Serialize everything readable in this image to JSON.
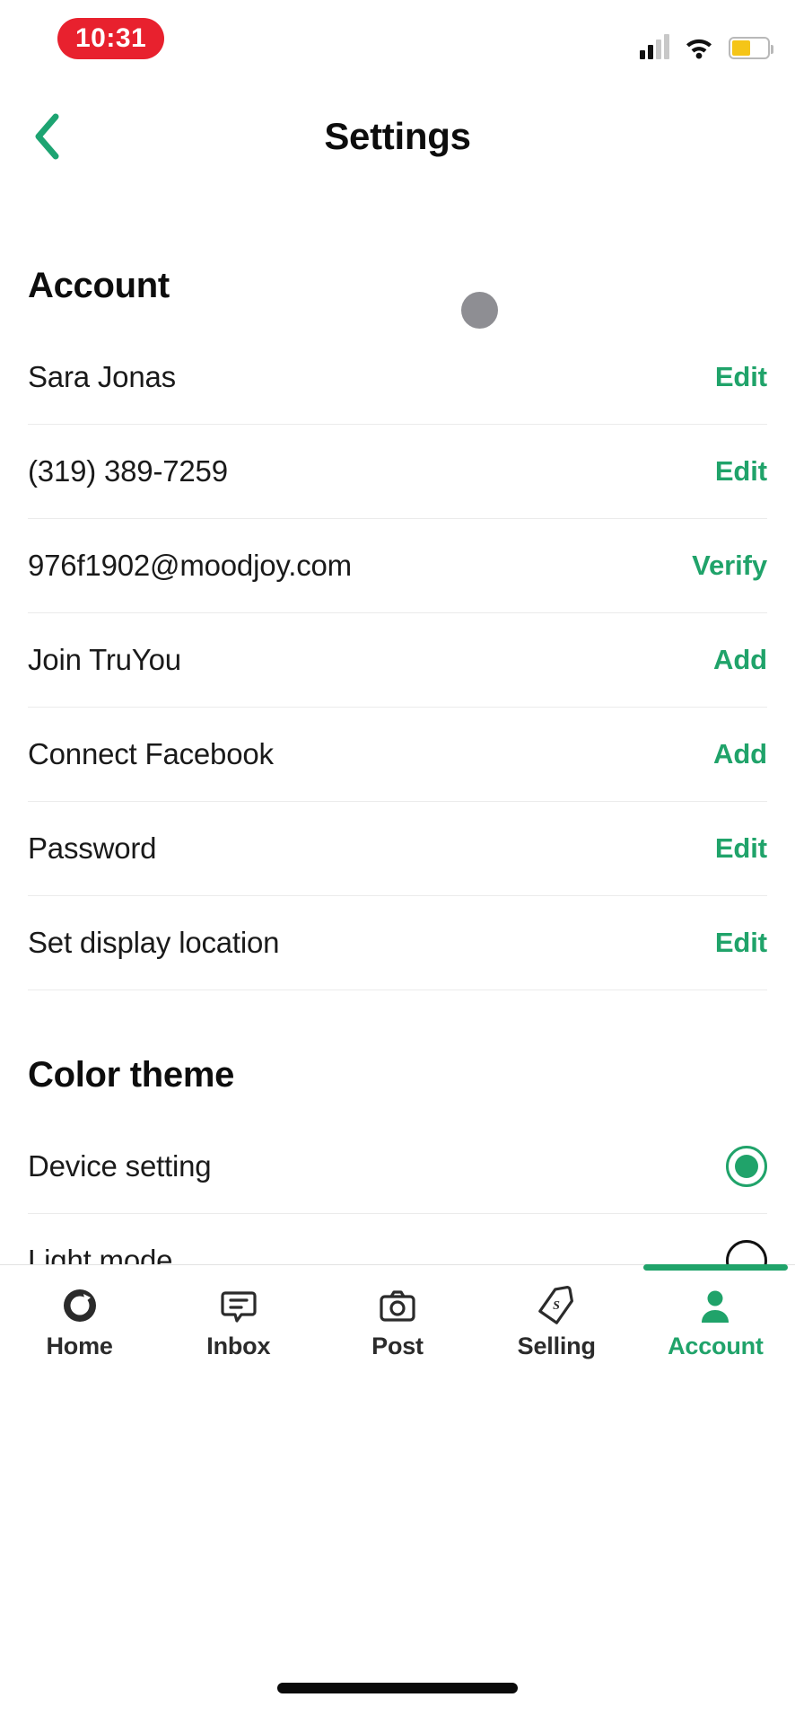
{
  "status_bar": {
    "time": "10:31",
    "time_pill_color": "#E8212E",
    "signal_icon": "cellular-signal-icon",
    "wifi_icon": "wifi-icon",
    "battery_icon": "battery-icon",
    "battery_fill_color": "#F5C518"
  },
  "header": {
    "title": "Settings",
    "back_icon": "chevron-left-icon",
    "accent_color": "#20A36A"
  },
  "account": {
    "section_title": "Account",
    "rows": [
      {
        "label": "Sara Jonas",
        "action": "Edit"
      },
      {
        "label": "(319) 389-7259",
        "action": "Edit"
      },
      {
        "label": "976f1902@moodjoy.com",
        "action": "Verify"
      },
      {
        "label": "Join TruYou",
        "action": "Add"
      },
      {
        "label": "Connect Facebook",
        "action": "Add"
      },
      {
        "label": "Password",
        "action": "Edit"
      },
      {
        "label": "Set display location",
        "action": "Edit"
      }
    ]
  },
  "color_theme": {
    "section_title": "Color theme",
    "options": [
      {
        "label": "Device setting",
        "selected": true
      },
      {
        "label": "Light mode",
        "selected": false
      }
    ]
  },
  "tabbar": {
    "items": [
      {
        "label": "Home",
        "icon": "home-logo-icon",
        "active": false
      },
      {
        "label": "Inbox",
        "icon": "message-bubble-icon",
        "active": false
      },
      {
        "label": "Post",
        "icon": "camera-icon",
        "active": false
      },
      {
        "label": "Selling",
        "icon": "price-tag-dollar-icon",
        "active": false
      },
      {
        "label": "Account",
        "icon": "person-icon",
        "active": true
      }
    ]
  }
}
